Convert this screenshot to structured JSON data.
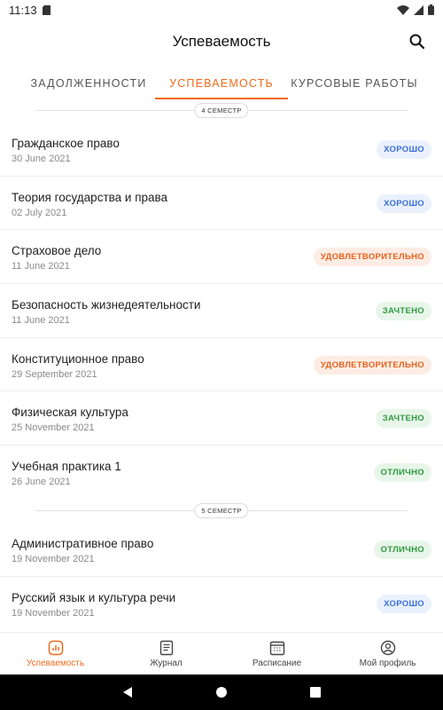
{
  "status_bar": {
    "time": "11:13"
  },
  "app_bar": {
    "title": "Успеваемость"
  },
  "tabs": [
    {
      "label": "ЗАДОЛЖЕННОСТИ",
      "active": false
    },
    {
      "label": "УСПЕВАЕМОСТЬ",
      "active": true
    },
    {
      "label": "КУРСОВЫЕ РАБОТЫ",
      "active": false
    }
  ],
  "semesters": [
    {
      "label": "4 СЕМЕСТР",
      "subjects": [
        {
          "name": "Гражданское право",
          "date": "30 June 2021",
          "grade": "ХОРОШО"
        },
        {
          "name": "Теория государства и права",
          "date": "02 July 2021",
          "grade": "ХОРОШО"
        },
        {
          "name": "Страховое дело",
          "date": "11 June 2021",
          "grade": "УДОВЛЕТВОРИТЕЛЬНО"
        },
        {
          "name": "Безопасность жизнедеятельности",
          "date": "11 June 2021",
          "grade": "ЗАЧТЕНО"
        },
        {
          "name": "Конституционное право",
          "date": "29 September 2021",
          "grade": "УДОВЛЕТВОРИТЕЛЬНО"
        },
        {
          "name": "Физическая культура",
          "date": "25 November 2021",
          "grade": "ЗАЧТЕНО"
        },
        {
          "name": "Учебная практика 1",
          "date": "26 June 2021",
          "grade": "ОТЛИЧНО"
        }
      ]
    },
    {
      "label": "5 СЕМЕСТР",
      "subjects": [
        {
          "name": "Административное право",
          "date": "19 November 2021",
          "grade": "ОТЛИЧНО"
        },
        {
          "name": "Русский язык и культура речи",
          "date": "19 November 2021",
          "grade": "ХОРОШО"
        }
      ]
    }
  ],
  "grade_colors": {
    "ХОРОШО": {
      "bg": "#eaf1fd",
      "fg": "#3a6fd8"
    },
    "УДОВЛЕТВОРИТЕЛЬНО": {
      "bg": "#fdece4",
      "fg": "#e8621c"
    },
    "ЗАЧТЕНО": {
      "bg": "#e8f6ea",
      "fg": "#2e9b3e"
    },
    "ОТЛИЧНО": {
      "bg": "#e8f6ea",
      "fg": "#2e9b3e"
    }
  },
  "bottom_nav": [
    {
      "label": "Успеваемость",
      "icon": "chart-icon",
      "active": true
    },
    {
      "label": "Журнал",
      "icon": "journal-icon",
      "active": false
    },
    {
      "label": "Расписание",
      "icon": "calendar-icon",
      "active": false
    },
    {
      "label": "Мой профиль",
      "icon": "profile-icon",
      "active": false
    }
  ],
  "accent_color": "#f26a1b"
}
